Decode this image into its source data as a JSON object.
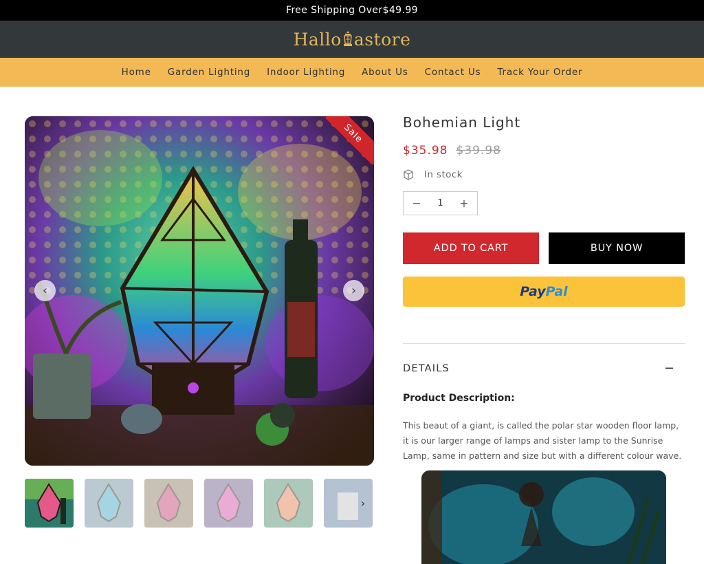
{
  "announcement": {
    "text": "Free Shipping Over$49.99"
  },
  "header": {
    "logo_left": "Hallo",
    "logo_right": "astore"
  },
  "nav": {
    "items": [
      "Home",
      "Garden Lighting",
      "Indoor Lighting",
      "About Us",
      "Contact Us",
      "Track Your Order"
    ]
  },
  "gallery": {
    "badge": "Sale",
    "prev_icon": "chevron-left-icon",
    "next_icon": "chevron-right-icon",
    "thumbnail_count": 6,
    "active_thumbnail": 1
  },
  "product": {
    "title": "Bohemian Light",
    "price": "$35.98",
    "compare_price": "$39.98",
    "stock": "In stock",
    "quantity": "1",
    "qty_minus": "−",
    "qty_plus": "+",
    "add_to_cart": "ADD TO CART",
    "buy_now": "BUY NOW",
    "paypal_pay": "Pay",
    "paypal_pal": "Pal"
  },
  "details": {
    "label": "DETAILS",
    "toggle": "−",
    "heading": "Product Description:",
    "text": "This beaut of a giant, is called the polar star wooden floor lamp, it is our larger range of lamps and sister lamp to the Sunrise Lamp, same in pattern and size but with a different colour wave."
  },
  "colors": {
    "announcement_bg": "#000000",
    "header_bg": "#33383b",
    "logo": "#e3b55d",
    "nav_bg": "#f2b955",
    "sale": "#d0262b",
    "price": "#c32a2a",
    "add_to_cart_bg": "#d0282d",
    "buy_now_bg": "#000000",
    "paypal_bg": "#fbc33a"
  }
}
